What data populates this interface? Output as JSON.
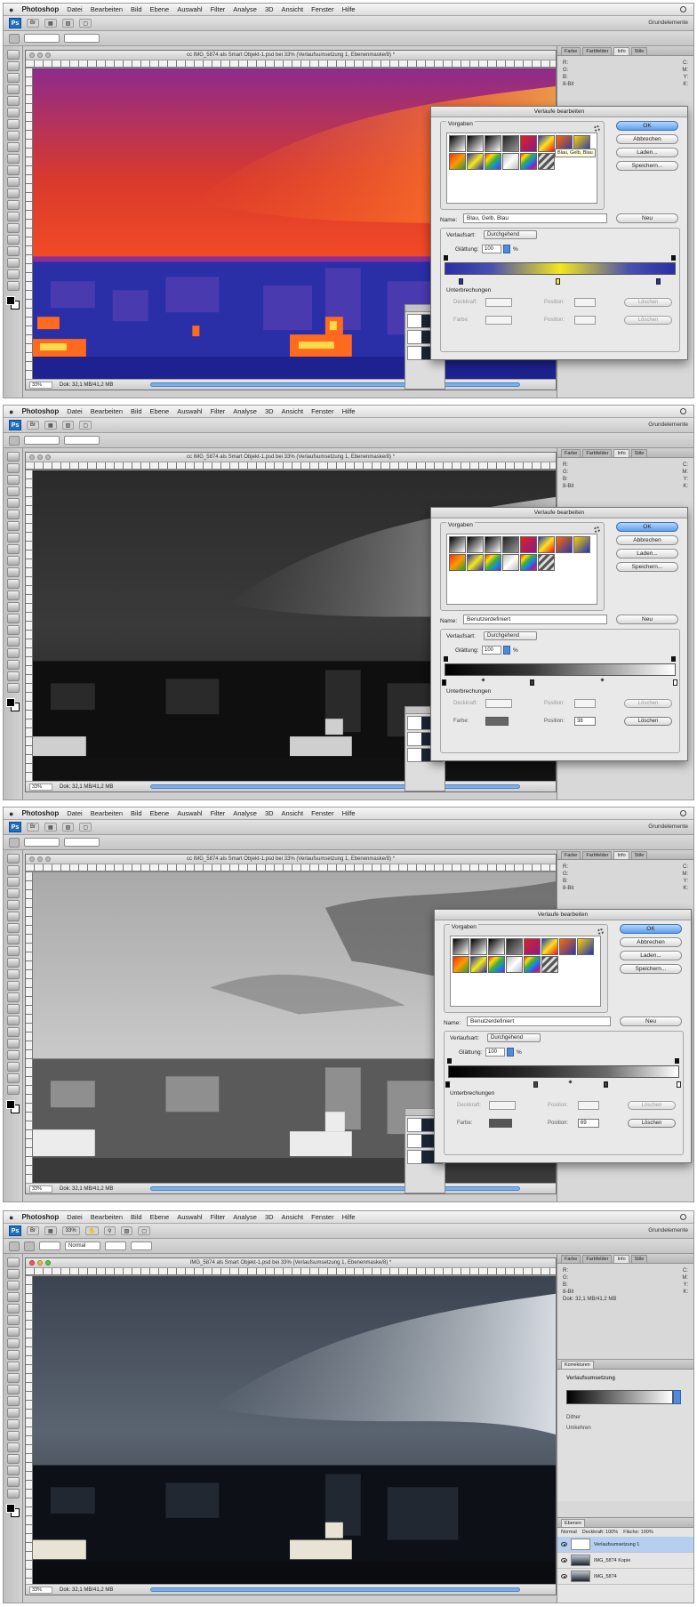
{
  "menubar": {
    "apple": "",
    "app": "Photoshop",
    "items": [
      "Datei",
      "Bearbeiten",
      "Bild",
      "Ebene",
      "Auswahl",
      "Filter",
      "Analyse",
      "3D",
      "Ansicht",
      "Fenster",
      "Hilfe"
    ]
  },
  "appbar": {
    "logo": "Ps",
    "workspace": "Grundelemente"
  },
  "doc_titles": {
    "s1": "cc IMG_5874 als Smart Objekt-1.psd bei 33% (Verlaufsumsetzung 1, Ebenenmaske/8) *",
    "s4": "IMG_5874 als Smart Objekt-1.psd bei 33% (Verlaufsumsetzung 1, Ebenenmaske/8) *"
  },
  "status": {
    "zoom": "33%",
    "doc": "Dok: 32,1 MB/41,2 MB"
  },
  "dialog": {
    "title": "Verlaufe bearbeiten",
    "presets": "Vorgaben",
    "ok": "OK",
    "cancel": "Abbrechen",
    "load": "Laden...",
    "save": "Speichern...",
    "name_label": "Name:",
    "new": "Neu",
    "gradient_type_label": "Verlaufsart:",
    "gradient_type_value": "Durchgehend",
    "smoothness_label": "Glättung:",
    "smoothness_value": "100",
    "percent": "%",
    "stops_legend": "Unterbrechungen",
    "opacity_label": "Deckkraft:",
    "color_label": "Farbe:",
    "position_label": "Position:",
    "delete": "Löschen",
    "tooltip": "Blau, Gelb, Blau"
  },
  "shots": [
    {
      "name_value": "Blau, Gelb, Blau",
      "color_position": ""
    },
    {
      "name_value": "Benutzerdefiniert",
      "color_position": "38"
    },
    {
      "name_value": "Benutzerdefiniert",
      "color_position": "69"
    }
  ],
  "panel": {
    "tabs": [
      "Farbe",
      "Farbfelder",
      "Info",
      "Stile"
    ],
    "adj_tab": "Korrekturen",
    "adj_title": "Verlaufsumsetzung",
    "dither": "Dither",
    "reverse": "Umkehren",
    "layers_tab": "Ebenen",
    "blend": "Normal",
    "opacity_lbl": "Deckkraft: 100%",
    "fill_lbl": "Fläche: 100%",
    "layer_names": [
      "Verlaufsumsetzung 1",
      "IMG_5874 Kopie",
      "IMG_5874"
    ]
  },
  "colors": {
    "dialog_bg": "#e9e9e9",
    "accent": "#5f9ee9",
    "gradient_blue": "#2a2fa8",
    "gradient_yellow": "#f4e81c"
  }
}
